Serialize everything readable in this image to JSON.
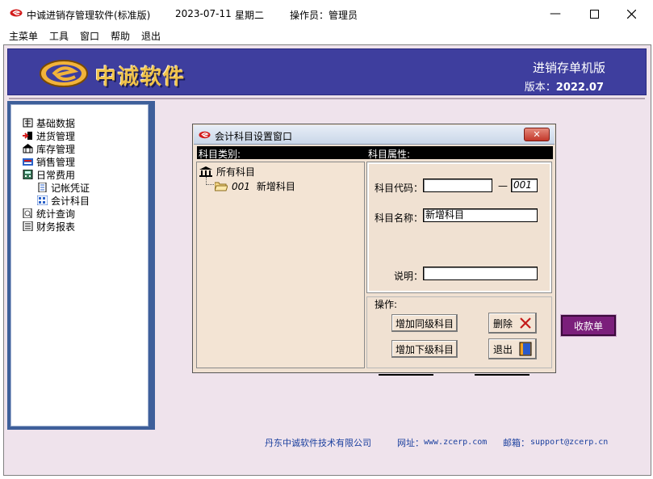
{
  "window": {
    "title": "中诚进销存管理软件(标准版)",
    "date": "2023-07-11",
    "weekday": "星期二",
    "operator": "操作员：管理员"
  },
  "menu": [
    "主菜单",
    "工具",
    "窗口",
    "帮助",
    "退出"
  ],
  "banner": {
    "title": "中诚软件",
    "edition": "进销存单机版",
    "version_label": "版本：",
    "version": "2022.07"
  },
  "sidebar": {
    "items": [
      {
        "label": "基础数据",
        "icon": "book-icon",
        "level": 0
      },
      {
        "label": "进货管理",
        "icon": "import-icon",
        "level": 0
      },
      {
        "label": "库存管理",
        "icon": "warehouse-icon",
        "level": 0
      },
      {
        "label": "销售管理",
        "icon": "sales-icon",
        "level": 0
      },
      {
        "label": "日常费用",
        "icon": "calculator-icon",
        "level": 0
      },
      {
        "label": "记帐凭证",
        "icon": "document-icon",
        "level": 1
      },
      {
        "label": "会计科目",
        "icon": "grid-icon",
        "level": 1
      },
      {
        "label": "统计查询",
        "icon": "search-doc-icon",
        "level": 0
      },
      {
        "label": "财务报表",
        "icon": "report-icon",
        "level": 0
      }
    ]
  },
  "background_button": {
    "label": "收款单"
  },
  "dialog": {
    "title": "会计科目设置窗口",
    "close": "✕",
    "left_header": "科目类别:",
    "right_header": "科目属性:",
    "tree": {
      "root": "所有科目",
      "children": [
        {
          "code": "001",
          "name": "新增科目"
        }
      ]
    },
    "fields": {
      "code_label": "科目代码：",
      "code_value": "",
      "dash": "—",
      "code_suffix": "001",
      "name_label": "科目名称：",
      "name_value": "新增科目",
      "desc_label": "说明：",
      "desc_value": ""
    },
    "ops": {
      "title": "操作:",
      "add_sibling": "增加同级科目",
      "add_child": "增加下级科目",
      "delete": "删除",
      "exit": "退出"
    }
  },
  "footer": {
    "company": "丹东中诚软件技术有限公司",
    "web_label": "网址：",
    "web": "www.zcerp.com",
    "mail_label": "邮箱：",
    "mail": "support@zcerp.cn"
  },
  "colors": {
    "banner": "#3e3e9e",
    "banner_title": "#f0c24a",
    "workspace": "#efe3ec",
    "sidebar_frame": "#3e5f9a",
    "receive_button": "#7b1f7b",
    "dialog_bg": "#f0e1d2"
  }
}
